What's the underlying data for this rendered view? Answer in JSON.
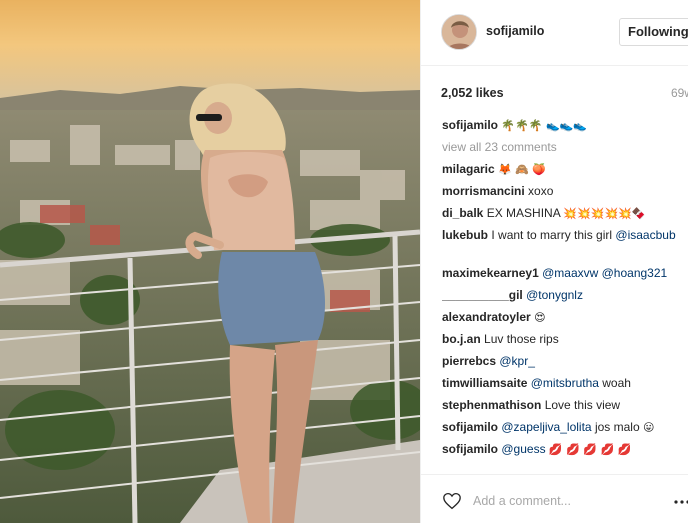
{
  "post": {
    "photo_description_icon": "photo-icon",
    "username": "sofijamilo",
    "follow_label": "Following",
    "likes": "2,052 likes",
    "time": "69w"
  },
  "comments": [
    {
      "user": "sofijamilo",
      "text": "",
      "emoji": "🌴🌴🌴 👟👟👟",
      "kind": "caption"
    },
    {
      "user": "",
      "text": "view all 23 comments",
      "kind": "view-all"
    },
    {
      "user": "milagaric",
      "text": "",
      "emoji": "🦊 🙈 🍑"
    },
    {
      "user": "morrismancini",
      "text": "xoxo"
    },
    {
      "user": "di_balk",
      "text": "EX MASHINA",
      "emoji": "💥💥💥💥💥🍫"
    },
    {
      "user": "lukebub",
      "text": "I want to marry this girl",
      "mention": "@isaacbub",
      "two_line": true
    },
    {
      "user": "maximekearney1",
      "mention": "@maaxvw @hoang321"
    },
    {
      "user": "__________gil",
      "mention": "@tonygnlz"
    },
    {
      "user": "alexandratoyler",
      "emoji": "😍"
    },
    {
      "user": "bo.j.an",
      "text": "Luv those rips"
    },
    {
      "user": "pierrebcs",
      "mention": "@kpr_"
    },
    {
      "user": "timwilliamsaite",
      "mention": "@mitsbrutha",
      "after": "woah"
    },
    {
      "user": "stephenmathison",
      "text": "Love this view"
    },
    {
      "user": "sofijamilo",
      "mention": "@zapeljiva_lolita",
      "after": "jos malo",
      "emoji": "😛"
    },
    {
      "user": "sofijamilo",
      "mention": "@guess",
      "emoji": "💋 💋 💋 💋 💋"
    }
  ],
  "add_comment": {
    "placeholder": "Add a comment..."
  },
  "colors": {
    "link": "#003569",
    "muted": "#999999",
    "border": "#efefef"
  }
}
